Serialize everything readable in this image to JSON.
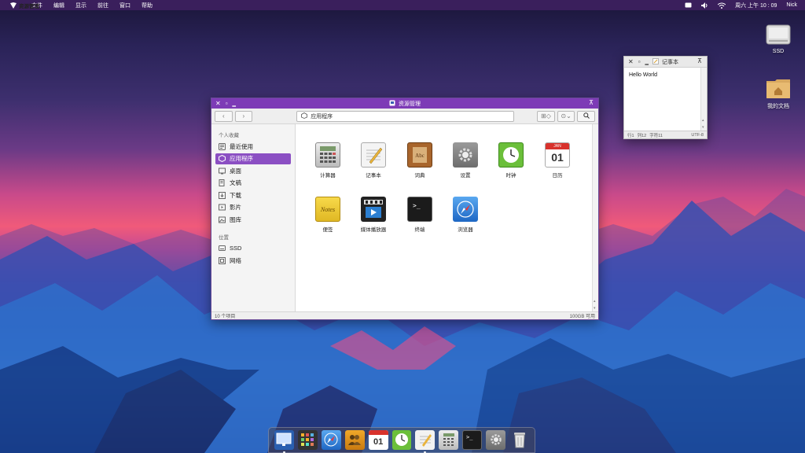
{
  "menubar": {
    "app_name": "资源管理",
    "menus": [
      "文件",
      "编辑",
      "显示",
      "前往",
      "窗口",
      "帮助"
    ],
    "clock": "周六 上午 10 : 09",
    "user": "Nick"
  },
  "desktop_icons": [
    {
      "label": "SSD",
      "icon": "drive-icon"
    },
    {
      "label": "我的文档",
      "icon": "home-folder-icon"
    }
  ],
  "file_manager": {
    "title": "资源管理",
    "path": "应用程序",
    "sidebar": {
      "favorites_header": "个人收藏",
      "favorites": [
        {
          "label": "最近使用",
          "icon": "recent-icon"
        },
        {
          "label": "应用程序",
          "icon": "apps-icon",
          "selected": true
        },
        {
          "label": "桌面",
          "icon": "desktop-icon"
        },
        {
          "label": "文稿",
          "icon": "documents-icon"
        },
        {
          "label": "下载",
          "icon": "download-icon"
        },
        {
          "label": "影片",
          "icon": "movies-icon"
        },
        {
          "label": "图库",
          "icon": "pictures-icon"
        }
      ],
      "places_header": "位置",
      "places": [
        {
          "label": "SSD",
          "icon": "drive-icon"
        },
        {
          "label": "网络",
          "icon": "network-icon"
        }
      ]
    },
    "apps": [
      {
        "label": "计算器",
        "icon": "calculator-icon"
      },
      {
        "label": "记事本",
        "icon": "notepad-icon"
      },
      {
        "label": "词典",
        "icon": "dictionary-icon"
      },
      {
        "label": "设置",
        "icon": "settings-icon"
      },
      {
        "label": "时钟",
        "icon": "clock-icon"
      },
      {
        "label": "日历",
        "icon": "calendar-icon"
      },
      {
        "label": "便签",
        "icon": "notes-icon"
      },
      {
        "label": "媒体播放器",
        "icon": "media-player-icon"
      },
      {
        "label": "终端",
        "icon": "terminal-icon"
      },
      {
        "label": "浏览器",
        "icon": "browser-icon"
      }
    ],
    "calendar_badge": {
      "month": "JAN",
      "day": "01"
    },
    "status_left": "10 个项目",
    "status_right": "100GB 可用"
  },
  "notepad": {
    "title": "记事本",
    "content": "Hello World",
    "status_line": "行1",
    "status_col": "列12",
    "status_chars": "字符11",
    "encoding": "UTF-8"
  },
  "dock": [
    "file-manager-icon",
    "launcher-icon",
    "browser-icon",
    "contacts-icon",
    "calendar-icon",
    "clock-icon",
    "notepad-icon",
    "calculator-icon",
    "terminal-icon",
    "settings-icon",
    "trash-icon"
  ],
  "dock_calendar_day": "01",
  "colors": {
    "accent": "#8b4fc3",
    "titlebar": "#7d3bb6",
    "menubar": "#3a1f5c"
  }
}
